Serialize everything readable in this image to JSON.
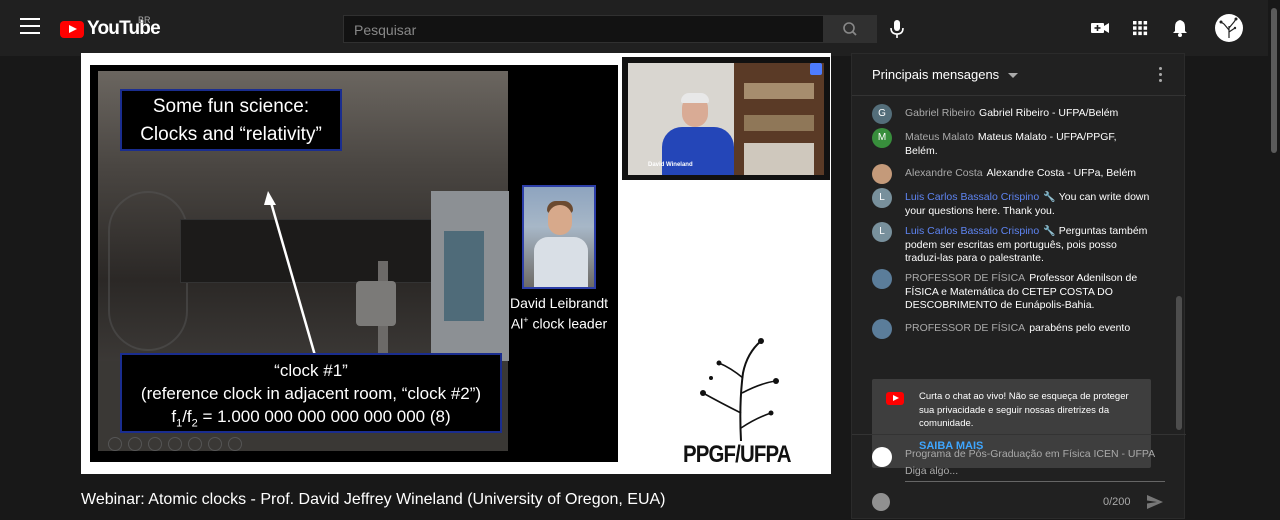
{
  "header": {
    "logo_text": "YouTube",
    "country": "BR",
    "search_placeholder": "Pesquisar"
  },
  "video": {
    "slide_title_line1": "Some fun science:",
    "slide_title_line2": "Clocks and “relativity”",
    "caption_line1": "“clock #1”",
    "caption_line2": "(reference clock in adjacent room, “clock #2”)",
    "caption_line3_prefix": "f",
    "caption_line3_sub1": "1",
    "caption_line3_mid": "/f",
    "caption_line3_sub2": "2",
    "caption_line3_rest": " = 1.000 000 000 000 000 000 (8)",
    "person_name": "David Leibrandt",
    "person_role_prefix": "Al",
    "person_role_sup": "+",
    "person_role_rest": " clock leader",
    "cam_name": "David Wineland",
    "logo_text": "PPGF/UFPA",
    "title": "Webinar: Atomic clocks - Prof. David Jeffrey Wineland (University of Oregon, EUA)"
  },
  "chat": {
    "header_title": "Principais mensagens",
    "messages": [
      {
        "initial": "G",
        "color": "#546e7a",
        "author": "Gabriel Ribeiro",
        "text": "Gabriel Ribeiro - UFPA/Belém",
        "moderator": false
      },
      {
        "initial": "M",
        "color": "#388e3c",
        "author": "Mateus Malato",
        "text": "Mateus Malato - UFPA/PPGF, Belém.",
        "moderator": false
      },
      {
        "initial": "",
        "color": "#c49a7a",
        "author": "Alexandre Costa",
        "text": "Alexandre Costa - UFPa, Belém",
        "moderator": false
      },
      {
        "initial": "L",
        "color": "#78909c",
        "author": "Luis Carlos Bassalo Crispino",
        "text": "You can write down your questions here. Thank you.",
        "moderator": true
      },
      {
        "initial": "L",
        "color": "#78909c",
        "author": "Luis Carlos Bassalo Crispino",
        "text": "Perguntas também podem ser escritas em português, pois posso traduzi-las para o palestrante.",
        "moderator": true
      },
      {
        "initial": "",
        "color": "#5b7d9a",
        "author": "PROFESSOR DE FÍSICA",
        "text": "Professor Adenilson de FÍSICA e Matemática do CETEP COSTA DO DESCOBRIMENTO de Eunápolis-Bahia.",
        "moderator": false
      },
      {
        "initial": "",
        "color": "#5b7d9a",
        "author": "PROFESSOR DE FÍSICA",
        "text": "parabéns pelo evento",
        "moderator": false
      }
    ],
    "notice_text": "Curta o chat ao vivo! Não se esqueça de proteger sua privacidade e seguir nossas diretrizes da comunidade.",
    "notice_link": "SAIBA MAIS",
    "input_author": "Programa de Pós-Graduação em Física ICEN - UFPA",
    "input_placeholder": "Diga algo...",
    "char_count": "0/200"
  }
}
